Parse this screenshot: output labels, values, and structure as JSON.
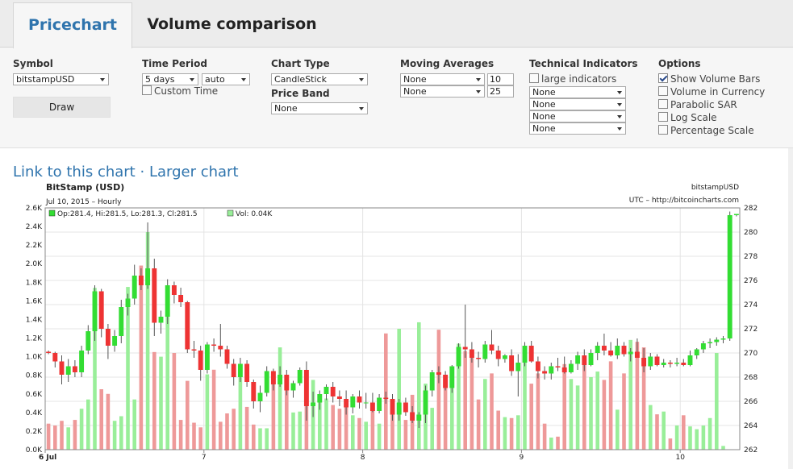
{
  "tabs": [
    {
      "label": "Pricechart",
      "active": true
    },
    {
      "label": "Volume comparison",
      "active": false
    }
  ],
  "controls": {
    "symbol": {
      "label": "Symbol",
      "value": "bitstampUSD",
      "button": "Draw"
    },
    "time_period": {
      "label": "Time Period",
      "value": "5 days",
      "interval": "auto",
      "custom_label": "Custom Time",
      "custom_checked": false
    },
    "chart_type": {
      "label": "Chart Type",
      "value": "CandleStick"
    },
    "price_band": {
      "label": "Price Band",
      "value": "None"
    },
    "moving_averages": {
      "label": "Moving Averages",
      "rows": [
        {
          "type": "None",
          "period": "10"
        },
        {
          "type": "None",
          "period": "25"
        }
      ]
    },
    "technical_indicators": {
      "label": "Technical Indicators",
      "large_label": "large indicators",
      "large_checked": false,
      "rows": [
        "None",
        "None",
        "None",
        "None"
      ]
    },
    "options": {
      "label": "Options",
      "items": [
        {
          "label": "Show Volume Bars",
          "checked": true
        },
        {
          "label": "Volume in Currency",
          "checked": false
        },
        {
          "label": "Parabolic SAR",
          "checked": false
        },
        {
          "label": "Log Scale",
          "checked": false
        },
        {
          "label": "Percentage Scale",
          "checked": false
        }
      ]
    }
  },
  "links": {
    "link_chart": "Link to this chart",
    "separator": "·",
    "larger_chart": "Larger chart"
  },
  "colors": {
    "up": "#33dd33",
    "down": "#ee3333",
    "vol_up": "#99ee99",
    "vol_down": "#ee9999",
    "link": "#2f74ad"
  },
  "chart_data": {
    "type": "candlestick",
    "title": "BitStamp (USD)",
    "subtitle": "Jul 10, 2015 – Hourly",
    "symbol_label": "bitstampUSD",
    "source_label": "UTC – http://bitcoincharts.com",
    "ohlc_label": "Op:281.4, Hi:281.5, Lo:281.3, Cl:281.5",
    "vol_label": "Vol: 0.04K",
    "y_price_ticks": [
      "282",
      "280",
      "278",
      "276",
      "274",
      "272",
      "270",
      "268",
      "266",
      "264",
      "262"
    ],
    "y_price_range": [
      262,
      282
    ],
    "y_volume_ticks": [
      "2.6K",
      "2.4K",
      "2.2K",
      "2.0K",
      "1.8K",
      "1.6K",
      "1.4K",
      "1.2K",
      "1.0K",
      "0.8K",
      "0.6K",
      "0.4K",
      "0.2K",
      "0.0K"
    ],
    "y_volume_range": [
      0,
      2600
    ],
    "x_labels": [
      {
        "label": "6 Jul",
        "bar": 0
      },
      {
        "label": "7",
        "bar": 24
      },
      {
        "label": "8",
        "bar": 48
      },
      {
        "label": "9",
        "bar": 72
      },
      {
        "label": "10",
        "bar": 96
      }
    ],
    "candles": [
      [
        270.1,
        270.2,
        269.9,
        270.0
      ],
      [
        270.0,
        270.1,
        268.8,
        269.3
      ],
      [
        269.3,
        269.8,
        267.4,
        268.2
      ],
      [
        268.2,
        269.5,
        267.6,
        268.9
      ],
      [
        268.9,
        269.4,
        268.0,
        268.4
      ],
      [
        268.4,
        270.6,
        268.0,
        270.2
      ],
      [
        270.2,
        272.3,
        269.9,
        271.8
      ],
      [
        271.8,
        275.6,
        271.0,
        275.1
      ],
      [
        275.1,
        275.3,
        271.3,
        272.0
      ],
      [
        272.0,
        272.4,
        269.5,
        270.6
      ],
      [
        270.6,
        271.9,
        270.1,
        271.4
      ],
      [
        271.4,
        274.4,
        270.8,
        273.8
      ],
      [
        273.8,
        274.9,
        273.1,
        274.5
      ],
      [
        274.5,
        277.3,
        274.0,
        276.4
      ],
      [
        276.4,
        277.0,
        275.2,
        275.6
      ],
      [
        275.6,
        280.8,
        275.3,
        277.0
      ],
      [
        277.0,
        277.8,
        271.4,
        272.5
      ],
      [
        272.5,
        273.5,
        271.6,
        273.0
      ],
      [
        273.0,
        276.1,
        272.4,
        275.6
      ],
      [
        275.6,
        275.9,
        274.1,
        274.8
      ],
      [
        274.8,
        275.4,
        273.8,
        274.2
      ],
      [
        274.2,
        274.3,
        270.0,
        270.3
      ],
      [
        270.3,
        271.0,
        269.6,
        270.2
      ],
      [
        270.2,
        270.6,
        267.7,
        268.6
      ],
      [
        268.6,
        270.9,
        268.3,
        270.7
      ],
      [
        270.7,
        271.2,
        270.1,
        270.6
      ],
      [
        270.6,
        272.4,
        269.7,
        270.3
      ],
      [
        270.3,
        270.6,
        268.7,
        269.1
      ],
      [
        269.1,
        269.5,
        267.3,
        268.0
      ],
      [
        268.0,
        269.6,
        267.6,
        269.1
      ],
      [
        269.1,
        269.4,
        267.2,
        267.6
      ],
      [
        267.6,
        267.8,
        265.4,
        266.0
      ],
      [
        266.0,
        267.3,
        265.1,
        266.7
      ],
      [
        266.7,
        268.9,
        266.4,
        268.5
      ],
      [
        268.5,
        268.7,
        266.9,
        267.4
      ],
      [
        267.4,
        268.9,
        267.2,
        268.2
      ],
      [
        268.2,
        268.6,
        266.5,
        266.9
      ],
      [
        266.9,
        267.7,
        266.3,
        267.5
      ],
      [
        267.5,
        268.8,
        267.3,
        268.6
      ],
      [
        268.6,
        269.3,
        264.4,
        265.6
      ],
      [
        265.6,
        266.8,
        264.7,
        265.9
      ],
      [
        265.9,
        266.9,
        265.3,
        266.6
      ],
      [
        266.6,
        267.4,
        266.1,
        267.2
      ],
      [
        267.2,
        267.6,
        265.9,
        266.4
      ],
      [
        266.4,
        266.9,
        265.6,
        266.2
      ],
      [
        266.2,
        266.9,
        264.9,
        265.5
      ],
      [
        265.5,
        266.6,
        265.0,
        266.4
      ],
      [
        266.4,
        266.9,
        265.4,
        265.9
      ],
      [
        265.9,
        266.7,
        265.4,
        265.9
      ],
      [
        265.9,
        266.7,
        265.1,
        265.2
      ],
      [
        265.2,
        266.6,
        265.0,
        266.3
      ],
      [
        266.3,
        266.8,
        265.8,
        266.2
      ],
      [
        266.2,
        266.6,
        264.4,
        264.9
      ],
      [
        264.9,
        266.2,
        264.4,
        265.9
      ],
      [
        265.9,
        266.3,
        264.8,
        265.1
      ],
      [
        265.1,
        265.6,
        264.2,
        264.4
      ],
      [
        264.4,
        265.1,
        263.8,
        264.9
      ],
      [
        264.9,
        267.3,
        264.2,
        266.9
      ],
      [
        266.9,
        268.6,
        266.4,
        268.4
      ],
      [
        268.4,
        268.9,
        267.5,
        268.2
      ],
      [
        268.2,
        268.5,
        266.9,
        267.1
      ],
      [
        267.1,
        269.0,
        266.7,
        268.9
      ],
      [
        268.9,
        270.8,
        268.7,
        270.5
      ],
      [
        270.5,
        274.0,
        269.6,
        270.3
      ],
      [
        270.3,
        270.9,
        269.2,
        269.6
      ],
      [
        269.6,
        270.1,
        268.8,
        269.5
      ],
      [
        269.5,
        271.0,
        269.2,
        270.7
      ],
      [
        270.7,
        271.9,
        269.9,
        270.2
      ],
      [
        270.2,
        270.6,
        268.9,
        269.5
      ],
      [
        269.5,
        269.9,
        269.2,
        269.8
      ],
      [
        269.8,
        270.3,
        268.1,
        268.5
      ],
      [
        268.5,
        269.9,
        266.4,
        269.2
      ],
      [
        269.2,
        270.9,
        268.9,
        270.6
      ],
      [
        270.6,
        271.0,
        269.2,
        269.3
      ],
      [
        269.3,
        269.7,
        267.9,
        268.5
      ],
      [
        268.5,
        268.9,
        267.8,
        268.3
      ],
      [
        268.3,
        269.2,
        267.8,
        268.9
      ],
      [
        268.9,
        269.6,
        268.5,
        268.8
      ],
      [
        268.8,
        269.7,
        268.3,
        268.4
      ],
      [
        268.4,
        269.4,
        268.3,
        269.1
      ],
      [
        269.1,
        270.1,
        268.6,
        269.8
      ],
      [
        269.8,
        270.3,
        268.5,
        269.0
      ],
      [
        269.0,
        270.3,
        268.9,
        270.0
      ],
      [
        270.0,
        270.9,
        269.4,
        270.6
      ],
      [
        270.6,
        271.6,
        269.8,
        270.2
      ],
      [
        270.2,
        270.9,
        269.7,
        269.8
      ],
      [
        269.8,
        271.2,
        269.5,
        270.6
      ],
      [
        270.6,
        270.9,
        269.7,
        269.9
      ],
      [
        269.9,
        270.4,
        269.3,
        270.1
      ],
      [
        270.1,
        271.2,
        269.6,
        269.6
      ],
      [
        269.6,
        270.4,
        268.4,
        268.9
      ],
      [
        268.9,
        270.0,
        268.6,
        269.7
      ],
      [
        269.7,
        269.9,
        268.9,
        269.0
      ],
      [
        269.0,
        269.5,
        268.8,
        269.2
      ],
      [
        269.2,
        269.4,
        268.8,
        269.1
      ],
      [
        269.1,
        269.6,
        268.9,
        269.2
      ],
      [
        269.2,
        269.5,
        268.9,
        269.0
      ],
      [
        269.0,
        270.2,
        268.9,
        269.8
      ],
      [
        269.8,
        270.4,
        269.5,
        270.3
      ],
      [
        270.3,
        271.0,
        270.0,
        270.8
      ],
      [
        270.8,
        271.2,
        270.4,
        270.9
      ],
      [
        270.9,
        271.3,
        270.6,
        271.1
      ],
      [
        271.1,
        271.4,
        270.8,
        271.2
      ],
      [
        271.2,
        281.7,
        271.0,
        281.4
      ],
      [
        281.4,
        281.5,
        281.3,
        281.5
      ]
    ],
    "volumes": [
      280,
      260,
      310,
      240,
      320,
      440,
      540,
      1740,
      650,
      600,
      310,
      360,
      1750,
      540,
      1980,
      2340,
      1050,
      1000,
      1460,
      1040,
      320,
      740,
      290,
      240,
      810,
      860,
      300,
      390,
      440,
      870,
      460,
      270,
      230,
      230,
      740,
      1100,
      720,
      400,
      410,
      830,
      750,
      540,
      550,
      480,
      440,
      510,
      370,
      340,
      300,
      430,
      280,
      1250,
      430,
      1300,
      320,
      590,
      1370,
      710,
      450,
      1290,
      710,
      810,
      1140,
      1060,
      1040,
      540,
      760,
      820,
      420,
      350,
      340,
      370,
      1050,
      710,
      820,
      280,
      130,
      140,
      920,
      760,
      690,
      1000,
      780,
      840,
      750,
      950,
      430,
      820,
      1180,
      1160,
      1100,
      480,
      380,
      410,
      120,
      260,
      370,
      250,
      220,
      260,
      340,
      1040,
      40
    ]
  }
}
